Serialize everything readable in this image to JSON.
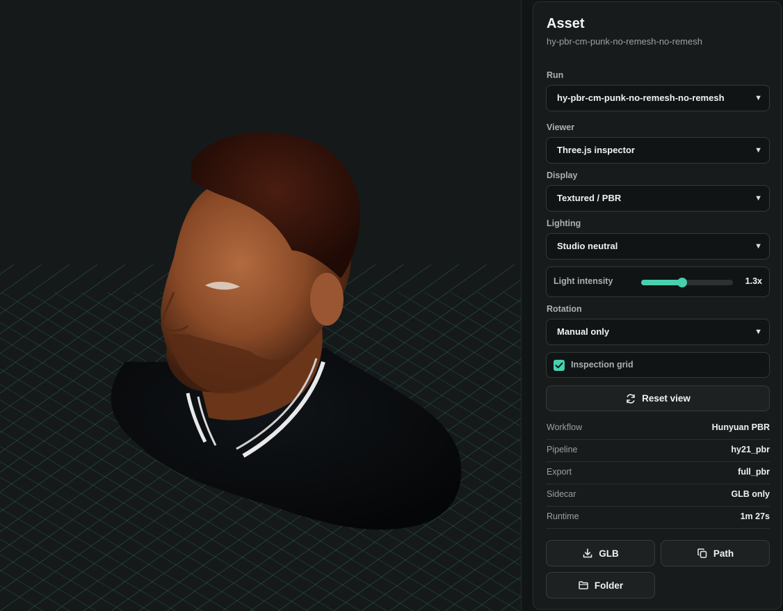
{
  "panel": {
    "title": "Asset",
    "subtitle": "hy-pbr-cm-punk-no-remesh-no-remesh"
  },
  "controls": {
    "run": {
      "label": "Run",
      "value": "hy-pbr-cm-punk-no-remesh-no-remesh"
    },
    "viewer": {
      "label": "Viewer",
      "value": "Three.js inspector"
    },
    "display": {
      "label": "Display",
      "value": "Textured / PBR"
    },
    "lighting": {
      "label": "Lighting",
      "value": "Studio neutral"
    },
    "light_intensity": {
      "label": "Light intensity",
      "value_text": "1.3x",
      "fraction": 0.45
    },
    "rotation": {
      "label": "Rotation",
      "value": "Manual only"
    },
    "inspection_grid": {
      "label": "Inspection grid",
      "checked": true
    },
    "reset_view": {
      "label": "Reset view",
      "icon": "refresh-icon"
    }
  },
  "info": [
    {
      "key": "Workflow",
      "value": "Hunyuan PBR"
    },
    {
      "key": "Pipeline",
      "value": "hy21_pbr"
    },
    {
      "key": "Export",
      "value": "full_pbr"
    },
    {
      "key": "Sidecar",
      "value": "GLB only"
    },
    {
      "key": "Runtime",
      "value": "1m 27s"
    }
  ],
  "actions": {
    "glb": {
      "label": "GLB",
      "icon": "download-icon"
    },
    "path": {
      "label": "Path",
      "icon": "copy-icon"
    },
    "folder": {
      "label": "Folder",
      "icon": "folder-icon"
    }
  },
  "colors": {
    "accent": "#48cfae",
    "background": "#121516",
    "panel": "#181b1c"
  }
}
